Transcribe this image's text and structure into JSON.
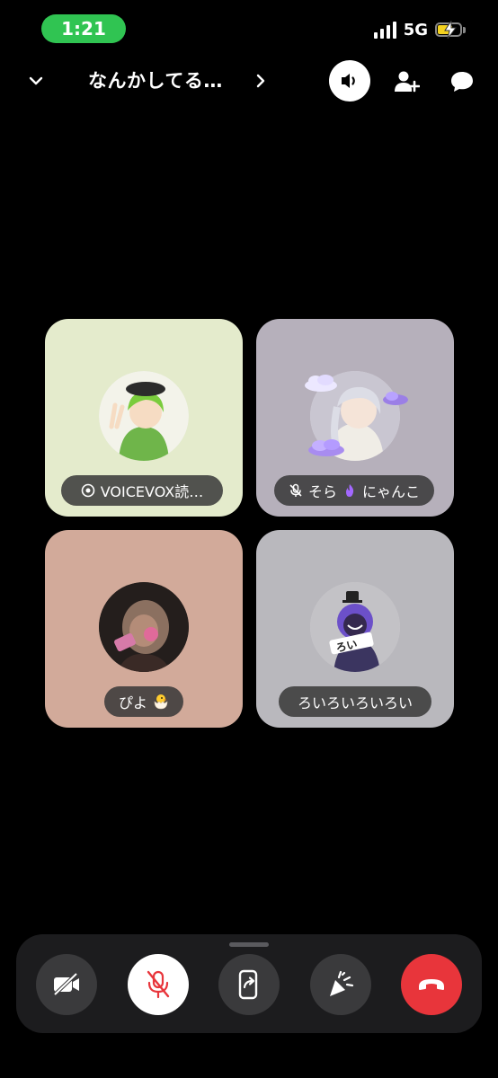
{
  "status_bar": {
    "time": "1:21",
    "network": "5G"
  },
  "header": {
    "title": "なんかしてる…"
  },
  "participants": [
    {
      "name": "VOICEVOX読…",
      "tile_color": "#e4ebcc",
      "avatar_bg": "#dfe8cf"
    },
    {
      "name": "そら",
      "extra_name": "にゃんこ",
      "muted": true,
      "tile_color": "#b6b0bb",
      "avatar_bg": "#d7d3dc"
    },
    {
      "name": "ぴよ",
      "tile_color": "#d2aa9a",
      "avatar_bg": "#2a2420"
    },
    {
      "name": "ろいろいろいろい",
      "tile_color": "#b9b8bd",
      "avatar_bg": "#cccbcf"
    }
  ],
  "controls": [
    "camera-off",
    "mic-off",
    "screen-share",
    "effects",
    "end-call"
  ],
  "colors": {
    "accent_green": "#30c452",
    "end_call_red": "#e8353b",
    "mic_off_red": "#e8353b"
  }
}
